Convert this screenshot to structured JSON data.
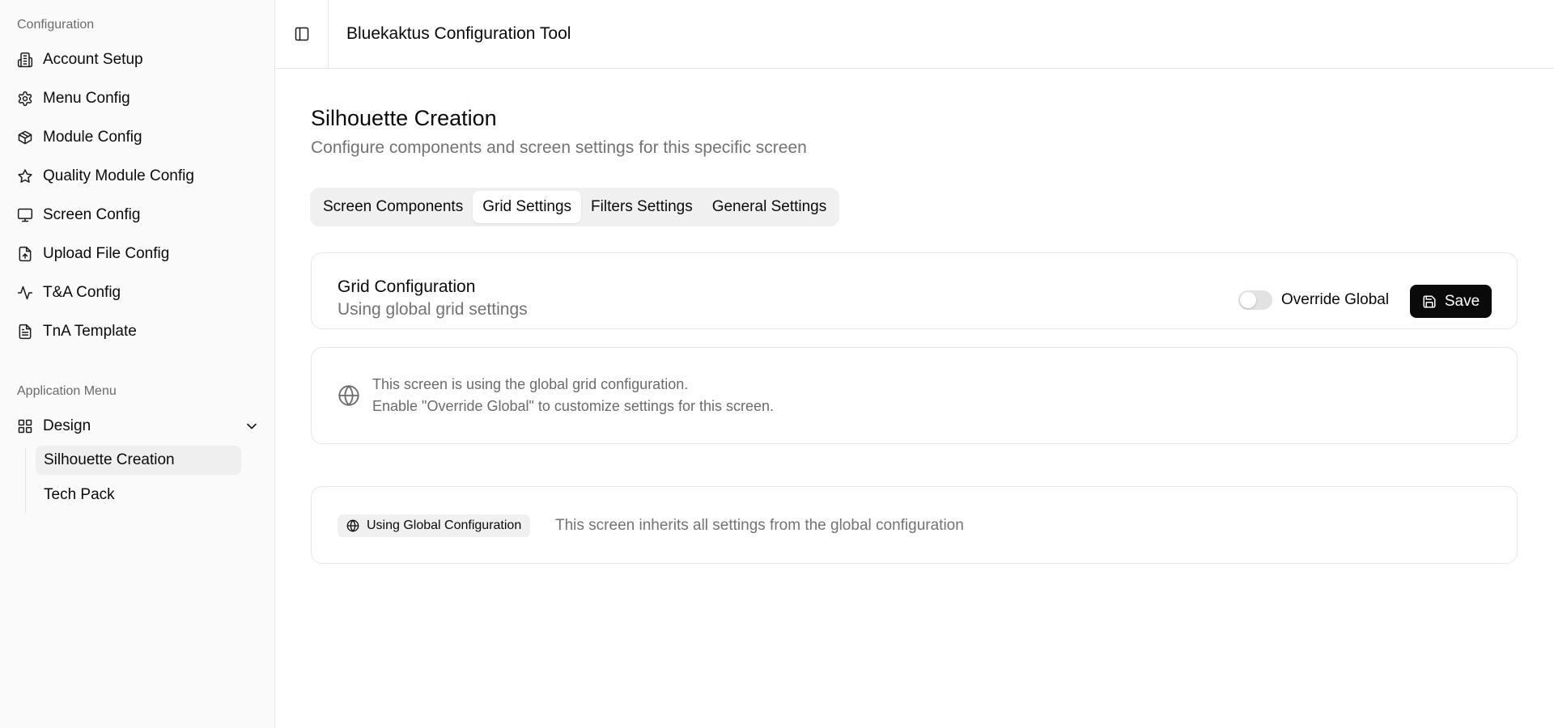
{
  "sidebar": {
    "config_label": "Configuration",
    "items": [
      {
        "label": "Account Setup",
        "icon": "building-icon"
      },
      {
        "label": "Menu Config",
        "icon": "gear-icon"
      },
      {
        "label": "Module Config",
        "icon": "box-icon"
      },
      {
        "label": "Quality Module Config",
        "icon": "star-icon"
      },
      {
        "label": "Screen Config",
        "icon": "monitor-icon"
      },
      {
        "label": "Upload File Config",
        "icon": "file-upload-icon"
      },
      {
        "label": "T&A Config",
        "icon": "activity-icon"
      },
      {
        "label": "TnA Template",
        "icon": "file-text-icon"
      }
    ],
    "app_menu_label": "Application Menu",
    "design_group": {
      "label": "Design",
      "icon": "grid-icon"
    },
    "sub_items": [
      {
        "label": "Silhouette Creation"
      },
      {
        "label": "Tech Pack"
      }
    ]
  },
  "header": {
    "title": "Bluekaktus Configuration Tool"
  },
  "main": {
    "title": "Silhouette Creation",
    "subtitle": "Configure components and screen settings for this specific screen",
    "tabs": [
      {
        "label": "Screen Components"
      },
      {
        "label": "Grid Settings"
      },
      {
        "label": "Filters Settings"
      },
      {
        "label": "General Settings"
      }
    ],
    "active_tab": "Grid Settings",
    "grid_card": {
      "title": "Grid Configuration",
      "subtitle": "Using global grid settings",
      "toggle_label": "Override Global",
      "toggle_on": false,
      "save_label": "Save"
    },
    "info_card": {
      "line1": "This screen is using the global grid configuration.",
      "line2": "Enable \"Override Global\" to customize settings for this screen."
    },
    "status_card": {
      "badge": "Using Global Configuration",
      "text": "This screen inherits all settings from the global configuration"
    }
  },
  "colors": {
    "primary_button": "#0a0a0a",
    "muted_text": "#737373",
    "border": "#e5e5e5",
    "sidebar_bg": "#fafafa"
  }
}
